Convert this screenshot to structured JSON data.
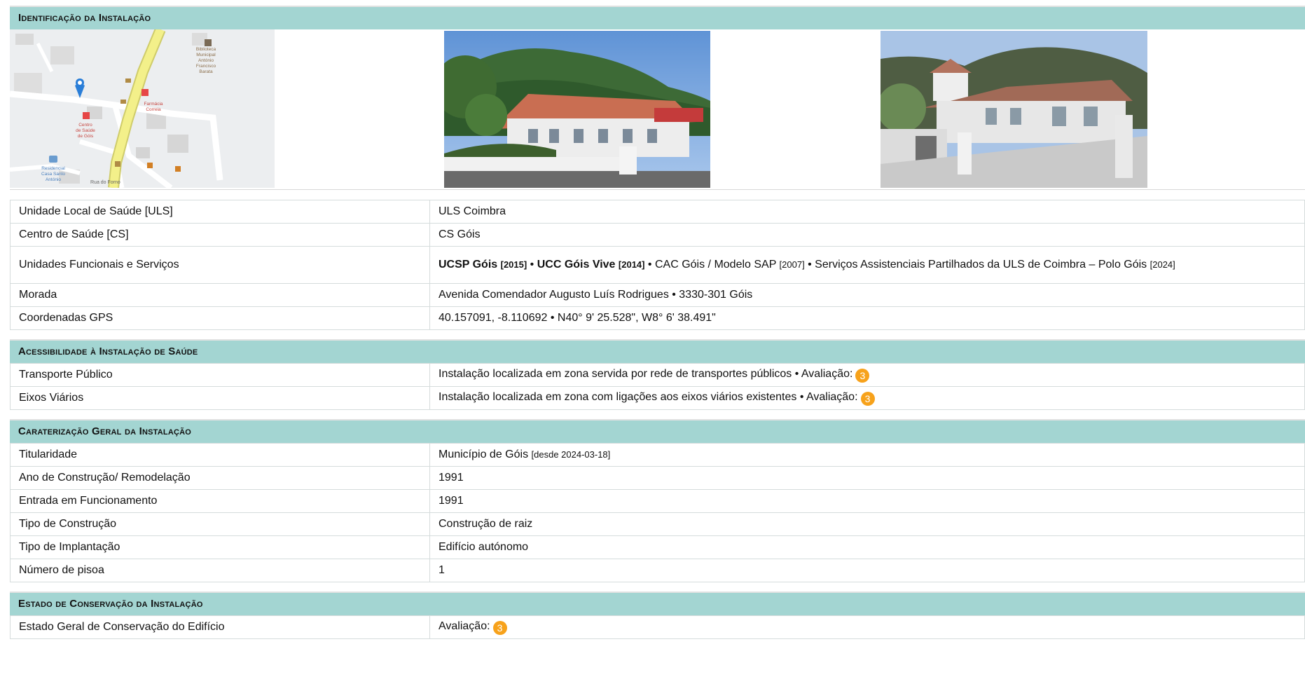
{
  "sections": {
    "identificacao": {
      "title": "Identificação da Instalação"
    },
    "acessibilidade": {
      "title": "Acessibilidade à Instalação de Saúde"
    },
    "caracterizacao": {
      "title": "Caraterização Geral da Instalação"
    },
    "conservacao": {
      "title": "Estado de Conservação da Instalação"
    }
  },
  "map": {
    "labels": [
      "Biblioteca",
      "Municipal",
      "António",
      "Francisco",
      "Barata",
      "Farmácia",
      "Correia",
      "Centro",
      "de Saúde",
      "de Góis",
      "Residencial",
      "Casa Santo",
      "António",
      "Rua do Forno"
    ]
  },
  "identificacao": {
    "rows": [
      {
        "label": "Unidade Local de Saúde [ULS]",
        "value": "ULS Coimbra"
      },
      {
        "label": "Centro de Saúde [CS]",
        "value": "CS Góis"
      },
      {
        "label": "Unidades Funcionais e Serviços"
      },
      {
        "label": "Morada",
        "value": "Avenida Comendador Augusto Luís Rodrigues • 3330-301 Góis"
      },
      {
        "label": "Coordenadas GPS",
        "value": "40.157091, -8.110692 • N40° 9' 25.528\", W8° 6' 38.491\""
      }
    ],
    "unidades": {
      "u1": "UCSP Góis",
      "y1": "[2015]",
      "sep1": " • ",
      "u2": "UCC Góis Vive",
      "y2": "[2014]",
      "t3": " • CAC Góis / Modelo SAP ",
      "y3": "[2007]",
      "t4": " • Serviços Assistenciais Partilhados da ULS de Coimbra – Polo Góis ",
      "y4": "[2024]"
    }
  },
  "acessibilidade": {
    "rows": [
      {
        "label": "Transporte Público",
        "value": "Instalação localizada em zona servida por rede de transportes públicos • Avaliação:",
        "rating": "3"
      },
      {
        "label": "Eixos Viários",
        "value": "Instalação localizada em zona com ligações aos eixos viários existentes • Avaliação:",
        "rating": "3"
      }
    ]
  },
  "caracterizacao": {
    "rows": [
      {
        "label": "Titularidade",
        "value": "Município de Góis ",
        "note": "[desde 2024-03-18]"
      },
      {
        "label": "Ano de Construção/ Remodelação",
        "value": "1991"
      },
      {
        "label": "Entrada em Funcionamento",
        "value": "1991"
      },
      {
        "label": "Tipo de Construção",
        "value": "Construção de raiz"
      },
      {
        "label": "Tipo de Implantação",
        "value": "Edifício autónomo"
      },
      {
        "label": "Número de pisoa",
        "value": "1"
      }
    ]
  },
  "conservacao": {
    "rows": [
      {
        "label": "Estado Geral de Conservação do Edifício",
        "value": "Avaliação:",
        "rating": "3"
      }
    ]
  },
  "colors": {
    "header": "#a3d5d2",
    "badge": "#f7a21b",
    "map_road": "#f3f08a"
  }
}
